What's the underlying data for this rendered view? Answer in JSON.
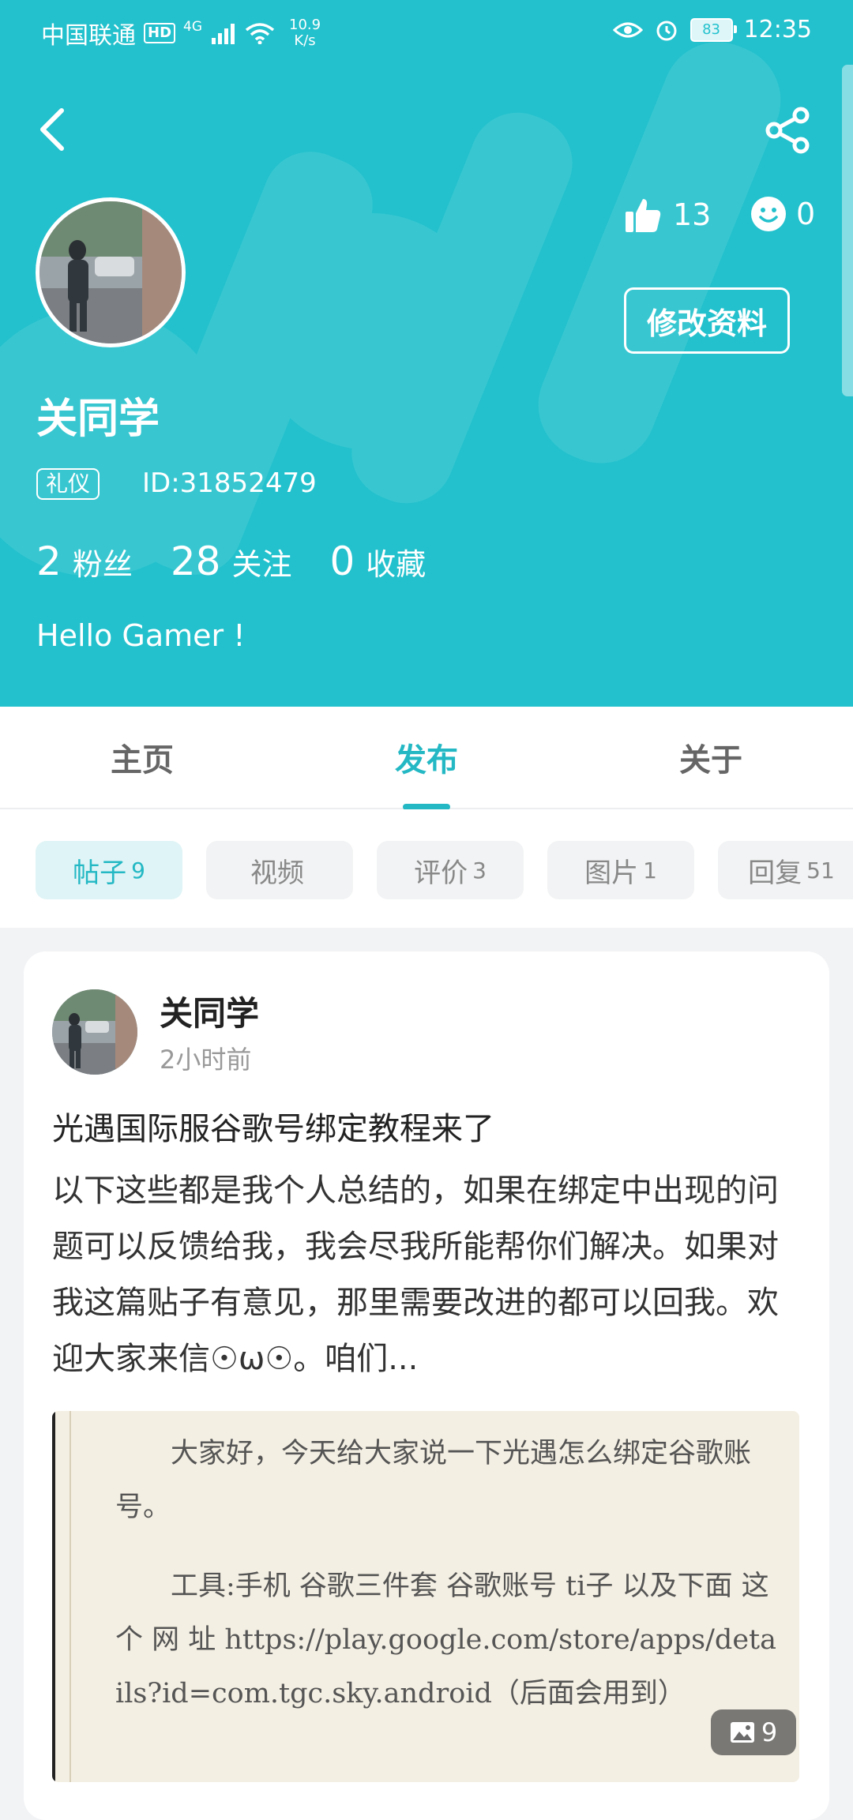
{
  "status_bar": {
    "carrier": "中国联通",
    "hd": "HD",
    "network": "4G",
    "speed_value": "10.9",
    "speed_unit": "K/s",
    "battery": "83",
    "time": "12:35"
  },
  "profile": {
    "name": "关同学",
    "tag": "礼仪",
    "id_text": "ID:31852479",
    "likes": "13",
    "smiles": "0",
    "edit_label": "修改资料",
    "stats": [
      {
        "num": "2",
        "label": "粉丝"
      },
      {
        "num": "28",
        "label": "关注"
      },
      {
        "num": "0",
        "label": "收藏"
      }
    ],
    "bio": "Hello Gamer !"
  },
  "tabs": [
    {
      "label": "主页"
    },
    {
      "label": "发布"
    },
    {
      "label": "关于"
    }
  ],
  "active_tab": "发布",
  "chips": [
    {
      "label": "帖子",
      "count": "9"
    },
    {
      "label": "视频",
      "count": ""
    },
    {
      "label": "评价",
      "count": "3"
    },
    {
      "label": "图片",
      "count": "1"
    },
    {
      "label": "回复",
      "count": "51"
    }
  ],
  "post": {
    "author": "关同学",
    "time": "2小时前",
    "title": "光遇国际服谷歌号绑定教程来了",
    "body": "以下这些都是我个人总结的，如果在绑定中出现的问题可以反馈给我，我会尽我所能帮你们解决。如果对 我这篇贴子有意见，那里需要改进的都可以回我。欢迎大家来信☉ω☉。咱们...",
    "image_text": [
      "大家好，今天给大家说一下光遇怎么绑定谷歌账号。",
      "工具:手机 谷歌三件套 谷歌账号 ti子 以及下面 这 个 网 址  https://play.google.com/store/apps/details?id=com.tgc.sky.android（后面会用到）"
    ],
    "image_count": "9"
  },
  "colors": {
    "accent": "#23c1cd",
    "accent_text": "#23b8c4"
  }
}
